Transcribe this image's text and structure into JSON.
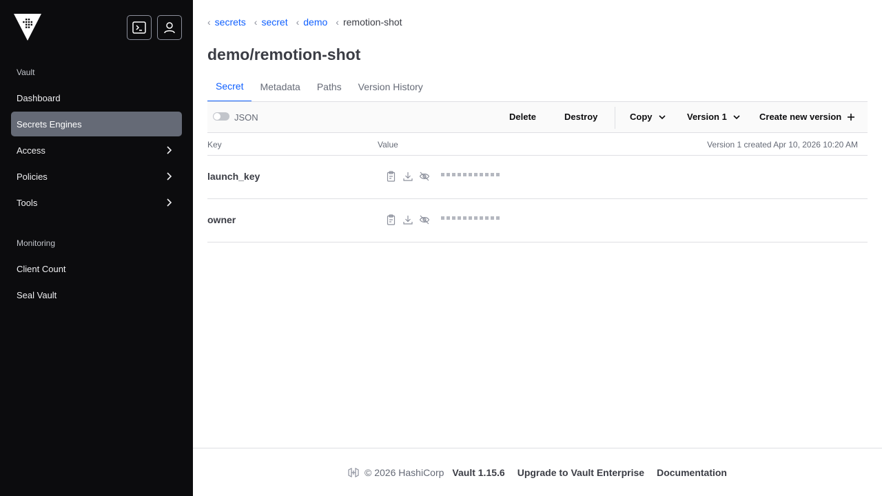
{
  "sidebar": {
    "sections": [
      {
        "title": "Vault",
        "items": [
          {
            "label": "Dashboard",
            "active": false,
            "chevron": false
          },
          {
            "label": "Secrets Engines",
            "active": true,
            "chevron": false
          },
          {
            "label": "Access",
            "active": false,
            "chevron": true
          },
          {
            "label": "Policies",
            "active": false,
            "chevron": true
          },
          {
            "label": "Tools",
            "active": false,
            "chevron": true
          }
        ]
      },
      {
        "title": "Monitoring",
        "items": [
          {
            "label": "Client Count",
            "active": false,
            "chevron": false
          },
          {
            "label": "Seal Vault",
            "active": false,
            "chevron": false
          }
        ]
      }
    ]
  },
  "breadcrumb": [
    {
      "label": "secrets",
      "link": true
    },
    {
      "label": "secret",
      "link": true
    },
    {
      "label": "demo",
      "link": true
    },
    {
      "label": "remotion-shot",
      "link": false
    }
  ],
  "page": {
    "title": "demo/remotion-shot"
  },
  "tabs": [
    {
      "label": "Secret",
      "active": true
    },
    {
      "label": "Metadata",
      "active": false
    },
    {
      "label": "Paths",
      "active": false
    },
    {
      "label": "Version History",
      "active": false
    }
  ],
  "toolbar": {
    "json_label": "JSON",
    "json_toggle_on": false,
    "delete_label": "Delete",
    "destroy_label": "Destroy",
    "copy_label": "Copy",
    "version_label": "Version 1",
    "create_label": "Create new version"
  },
  "table": {
    "columns": {
      "key": "Key",
      "value": "Value"
    },
    "version_meta": "Version 1 created Apr 10, 2026 10:20 AM",
    "rows": [
      {
        "key": "launch_key",
        "masked": true
      },
      {
        "key": "owner",
        "masked": true
      }
    ]
  },
  "footer": {
    "copyright": "© 2026 HashiCorp",
    "version": "Vault 1.15.6",
    "upgrade": "Upgrade to Vault Enterprise",
    "docs": "Documentation"
  },
  "colors": {
    "sidebar_bg": "#0c0c0e",
    "active_nav_bg": "#656a76",
    "link_blue": "#1060ff",
    "border": "#dedfe3"
  },
  "icons": {
    "logo": "vault-logo-icon",
    "console": "terminal-icon",
    "user": "user-icon",
    "copy": "clipboard-icon",
    "download": "download-icon",
    "reveal": "eye-off-icon"
  }
}
